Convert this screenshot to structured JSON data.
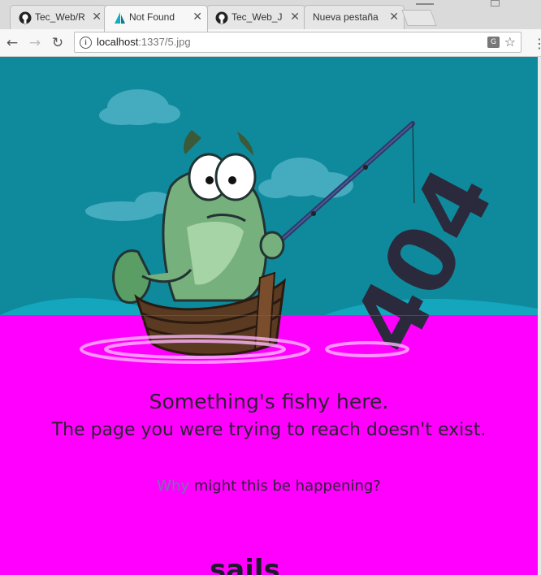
{
  "browser": {
    "tabs": [
      {
        "label": "Tec_Web/R",
        "icon": "github-icon"
      },
      {
        "label": "Not Found",
        "icon": "sails-icon"
      },
      {
        "label": "Tec_Web_J",
        "icon": "github-icon"
      },
      {
        "label": "Nueva pestaña",
        "icon": ""
      }
    ],
    "address": {
      "host": "localhost",
      "path": ":1337/5.jpg"
    },
    "icons": {
      "back": "back-arrow-icon",
      "forward": "forward-arrow-icon",
      "reload": "reload-icon",
      "info": "info-icon",
      "translate": "translate-icon",
      "star": "star-icon",
      "menu": "menu-icon"
    }
  },
  "page": {
    "error_code": "404",
    "heading": "Something's fishy here.",
    "subheading": "The page you were trying to reach doesn't exist.",
    "why_link": "Why",
    "why_rest": " might this be happening?",
    "logo_text": "sails"
  },
  "colors": {
    "sky": "#0f8a9c",
    "water": "#ff00ff",
    "text": "#2a2232",
    "link": "#7a6fb3",
    "code": "#2b2a3c"
  }
}
